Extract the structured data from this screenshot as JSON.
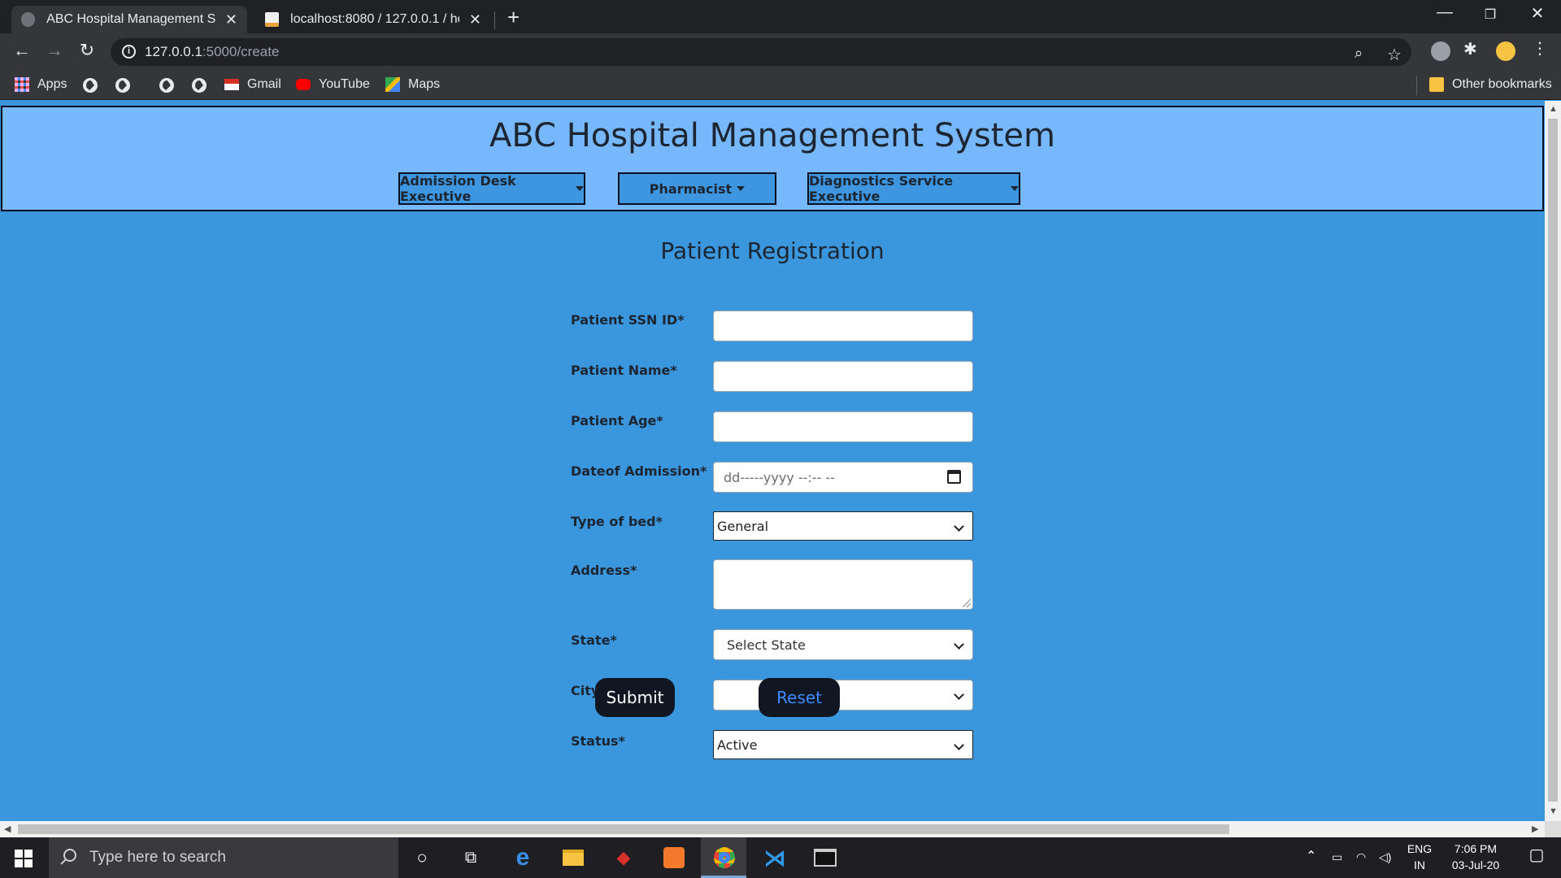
{
  "browser": {
    "tabs": [
      {
        "title": "ABC Hospital Management Syste",
        "active": true
      },
      {
        "title": "localhost:8080 / 127.0.0.1 / hospi",
        "active": false
      }
    ],
    "url_host": "127.0.0.1",
    "url_path": ":5000/create",
    "bookmarks": [
      "Apps",
      "Gmail",
      "YouTube",
      "Maps"
    ],
    "other_bookmarks": "Other bookmarks"
  },
  "header": {
    "title": "ABC Hospital Management System",
    "menus": [
      "Admission Desk Executive",
      "Pharmacist",
      "Diagnostics Service Executive"
    ]
  },
  "form": {
    "title": "Patient Registration",
    "fields": [
      {
        "label": "Patient SSN ID*",
        "type": "text",
        "value": ""
      },
      {
        "label": "Patient Name*",
        "type": "text",
        "value": ""
      },
      {
        "label": "Patient Age*",
        "type": "text",
        "value": ""
      },
      {
        "label": "Dateof Admission*",
        "type": "datetime",
        "placeholder": "dd-----yyyy --:-- --"
      },
      {
        "label": "Type of bed*",
        "type": "select",
        "value": "General"
      },
      {
        "label": "Address*",
        "type": "textarea",
        "value": ""
      },
      {
        "label": "State*",
        "type": "select",
        "value": "Select State"
      },
      {
        "label": "City*",
        "type": "select",
        "value": ""
      },
      {
        "label": "Status*",
        "type": "select",
        "value": "Active"
      }
    ],
    "submit_label": "Submit",
    "reset_label": "Reset"
  },
  "taskbar": {
    "search_placeholder": "Type here to search",
    "lang_top": "ENG",
    "lang_bottom": "IN",
    "time": "7:06 PM",
    "date": "03-Jul-20"
  },
  "colors": {
    "page_bg": "#3a97de",
    "header_bg": "#76b8fb",
    "reset_text": "#3b8cff"
  }
}
